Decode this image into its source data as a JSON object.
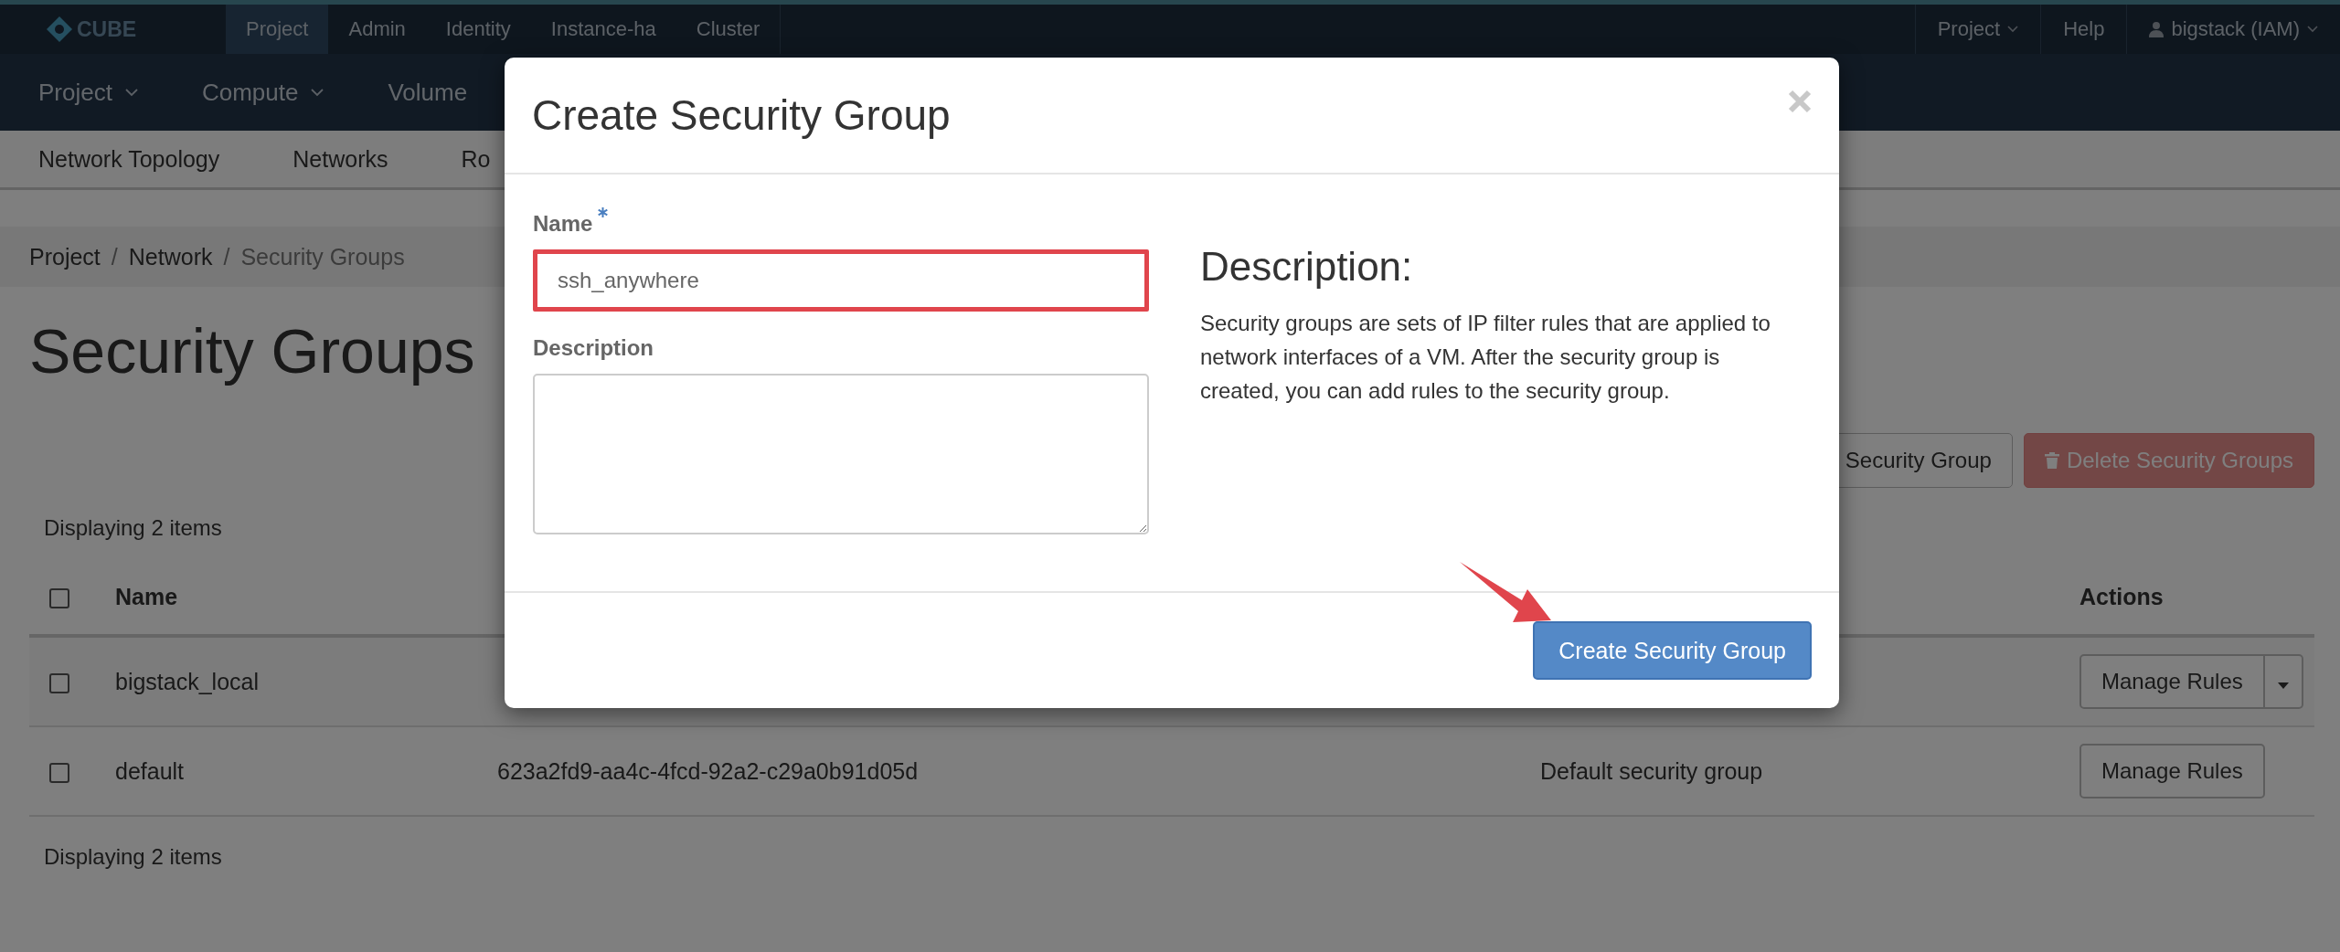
{
  "top_nav": {
    "logo": "CUBE",
    "tabs": [
      {
        "label": "Project",
        "selected": true
      },
      {
        "label": "Admin",
        "selected": false
      },
      {
        "label": "Identity",
        "selected": false
      },
      {
        "label": "Instance-ha",
        "selected": false
      },
      {
        "label": "Cluster",
        "selected": false
      }
    ],
    "right": [
      {
        "kind": "dropdown",
        "label": "Project"
      },
      {
        "kind": "link",
        "label": "Help"
      },
      {
        "kind": "user",
        "label": "bigstack (IAM)"
      }
    ]
  },
  "sub_nav": [
    {
      "label": "Project",
      "dropdown": true
    },
    {
      "label": "Compute",
      "dropdown": true
    },
    {
      "label": "Volume",
      "dropdown": false
    }
  ],
  "section_nav": [
    "Network Topology",
    "Networks",
    "Ro"
  ],
  "breadcrumb": [
    {
      "label": "Project",
      "separator": "/"
    },
    {
      "label": "Network",
      "separator": "/"
    },
    {
      "label": "Security Groups"
    }
  ],
  "page_title": "Security Groups",
  "actions": [
    {
      "kind": "default",
      "label": "Security Group",
      "disabled": false
    },
    {
      "kind": "danger",
      "label": "Delete Security Groups",
      "disabled": true
    }
  ],
  "table": {
    "count_top": "Displaying 2 items",
    "select_all_checked": false,
    "columns": {
      "name": "Name",
      "actions": "Actions"
    },
    "rows": [
      {
        "checked": false,
        "name": "bigstack_local",
        "actions": [
          {
            "kind": "split",
            "label": "Manage Rules"
          }
        ]
      },
      {
        "checked": false,
        "name": "default",
        "id": "623a2fd9-aa4c-4fcd-92a2-c29a0b91d05d",
        "description": "Default security group",
        "actions": [
          {
            "kind": "plain",
            "label": "Manage Rules"
          }
        ]
      }
    ],
    "count_bottom": "Displaying 2 items"
  },
  "modal": {
    "title": "Create Security Group",
    "fields": [
      {
        "kind": "input",
        "label": "Name",
        "required": true,
        "value": "ssh_anywhere",
        "highlighted": true
      },
      {
        "kind": "textarea",
        "label": "Description",
        "required": false,
        "highlighted": false
      }
    ],
    "help_title": "Description:",
    "help_text": "Security groups are sets of IP filter rules that are applied to network interfaces of a VM. After the security group is created, you can add rules to the security group.",
    "submit": "Create Security Group"
  }
}
